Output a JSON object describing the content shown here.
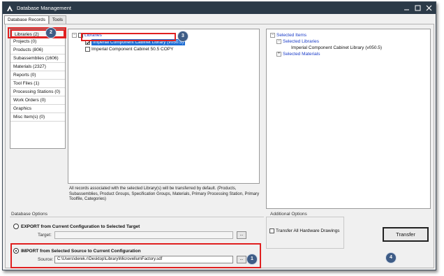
{
  "window": {
    "title": "Database Management"
  },
  "tabs": [
    {
      "label": "Database Records"
    },
    {
      "label": "Tools"
    }
  ],
  "nav": {
    "items": [
      {
        "label": "Libraries (2)"
      },
      {
        "label": "Projects (0)"
      },
      {
        "label": "Products (806)"
      },
      {
        "label": "Subassemblies (1606)"
      },
      {
        "label": "Materials (2327)"
      },
      {
        "label": "Reports (0)"
      },
      {
        "label": "Tool Files (1)"
      },
      {
        "label": "Processing Stations (0)"
      },
      {
        "label": "Work Orders (0)"
      },
      {
        "label": "Graphics"
      },
      {
        "label": "Misc Item(s) (0)"
      }
    ]
  },
  "libraries_tree": {
    "root": "Libraries",
    "items": [
      {
        "label": "Imperial Component Cabinet Library (v050.5)",
        "checked": true,
        "highlighted": true
      },
      {
        "label": "Imperial Component Cabinet 50.5 COPY",
        "checked": false
      }
    ],
    "note": "All records associated with the selected Library(s) will be transferred by default.  (Products, Subassemblies, Product Groups, Specification Groups, Materials, Primary Processing Station, Primary Toolfile, Categories)"
  },
  "selected_items": {
    "root": "Selected Items",
    "libraries_label": "Selected Libraries",
    "library_entry": "Imperial Component Cabinet Library (v050.5)",
    "materials_label": "Selected Materials"
  },
  "database_options": {
    "title": "Database Options",
    "export_label": "EXPORT from Current Configuration to Selected Target",
    "target_label": "Target:",
    "target_value": "",
    "import_label": "IMPORT from Selected Source to Current Configuration",
    "source_label": "Source:",
    "source_value": "C:\\Users\\derek.r\\Desktop\\Library\\MicrovellumFactory.sdf",
    "browse_label": "..."
  },
  "additional_options": {
    "title": "Additional Options",
    "hardware_label": "Transfer All Hardware Drawings"
  },
  "transfer_label": "Transfer",
  "callouts": {
    "c1": "1",
    "c2": "2",
    "c3": "3",
    "c4": "4"
  },
  "icons": {
    "app": "app-logo-icon",
    "minimize": "minimize-icon",
    "maximize": "maximize-icon",
    "close": "close-icon",
    "expand": "tree-collapse-icon",
    "collapse": "tree-expand-icon",
    "check": "checkmark-icon"
  },
  "colors": {
    "titlebar": "#2b3a48",
    "highlight": "#1f6ed4",
    "annotation": "#e02020",
    "callout": "#3e5c86",
    "tree_text": "#1a3cc8"
  }
}
